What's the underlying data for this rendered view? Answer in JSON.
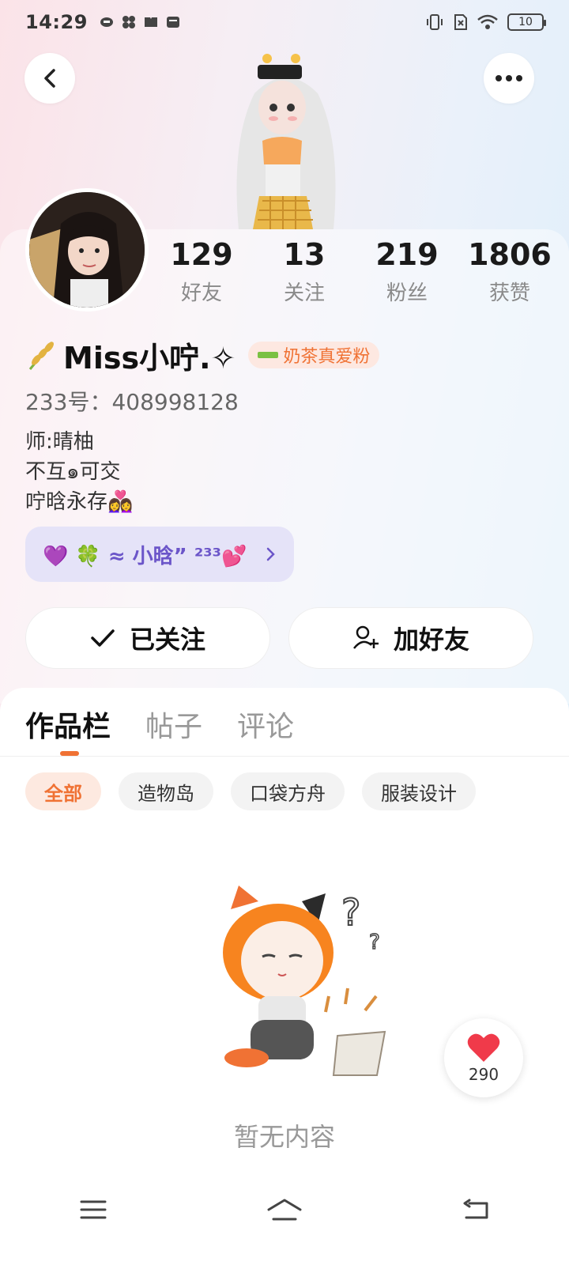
{
  "status_bar": {
    "time": "14:29",
    "battery": "10",
    "left_icons": [
      "app-icon-1",
      "app-icon-2",
      "book-icon",
      "wallet-icon"
    ],
    "right_icons": [
      "vibrate-icon",
      "no-sim-icon",
      "wifi-icon",
      "battery-icon"
    ]
  },
  "header": {
    "back_icon": "chevron-left-icon",
    "more_icon": "more-horizontal-icon"
  },
  "profile": {
    "stats": [
      {
        "value": "129",
        "label": "好友"
      },
      {
        "value": "13",
        "label": "关注"
      },
      {
        "value": "219",
        "label": "粉丝"
      },
      {
        "value": "1806",
        "label": "获赞"
      }
    ],
    "name": "Miss小咛.✧",
    "badge": "奶茶真爱粉",
    "uid_label": "233号：",
    "uid": "408998128",
    "bio": [
      "师:晴柚",
      "不互๑可交",
      "咛晗永存👩‍❤️‍👩"
    ],
    "group_chip": "💜 🍀 ≈ 小晗” ²³³💕",
    "follow_button": "已关注",
    "add_friend_button": "加好友"
  },
  "tabs": [
    {
      "label": "作品栏",
      "active": true
    },
    {
      "label": "帖子",
      "active": false
    },
    {
      "label": "评论",
      "active": false
    }
  ],
  "filters": [
    {
      "label": "全部",
      "active": true
    },
    {
      "label": "造物岛",
      "active": false
    },
    {
      "label": "口袋方舟",
      "active": false
    },
    {
      "label": "服装设计",
      "active": false
    }
  ],
  "empty_state": {
    "text": "暂无内容"
  },
  "like_fab": {
    "count": "290"
  },
  "colors": {
    "accent": "#f07234",
    "chip_purple": "#6b55c9"
  }
}
